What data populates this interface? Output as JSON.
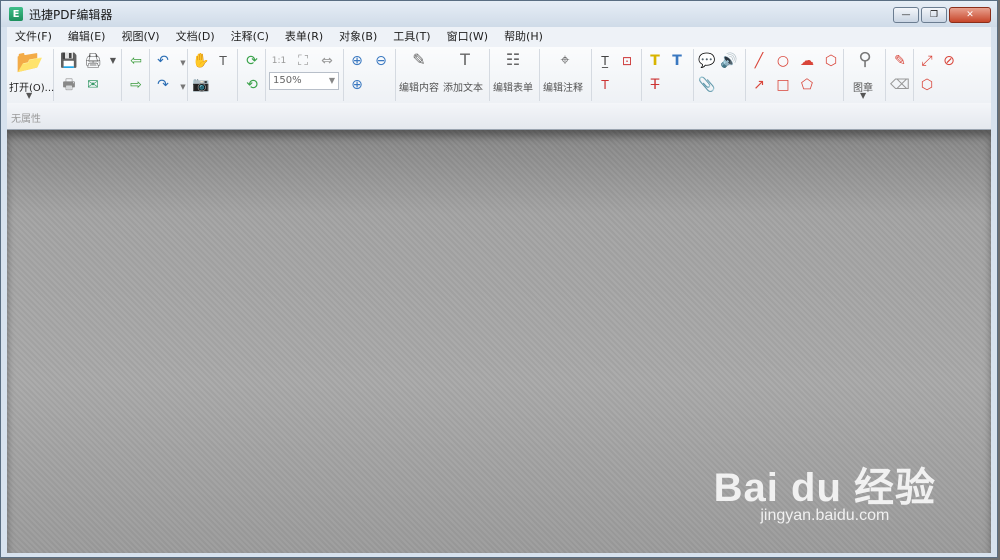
{
  "window": {
    "title": "迅捷PDF编辑器",
    "app_icon": "E"
  },
  "window_controls": {
    "minimize": "—",
    "restore": "❐",
    "close": "✕"
  },
  "menu": [
    "文件(F)",
    "编辑(E)",
    "视图(V)",
    "文档(D)",
    "注释(C)",
    "表单(R)",
    "对象(B)",
    "工具(T)",
    "窗口(W)",
    "帮助(H)"
  ],
  "toolbar": {
    "open_label": "打开(O)...",
    "zoom_value": "150%",
    "edit_content": "编辑内容",
    "add_text": "添加文本",
    "edit_form": "编辑表单",
    "edit_annotation": "编辑注释",
    "stamp": "图章"
  },
  "properties": {
    "status": "无属性"
  },
  "watermark": {
    "logo": "Bai du 经验",
    "url": "jingyan.baidu.com"
  },
  "colors": {
    "accent": "#2a6fb0",
    "workspace": "#a5a5a5",
    "window_border": "#5a6e82"
  }
}
